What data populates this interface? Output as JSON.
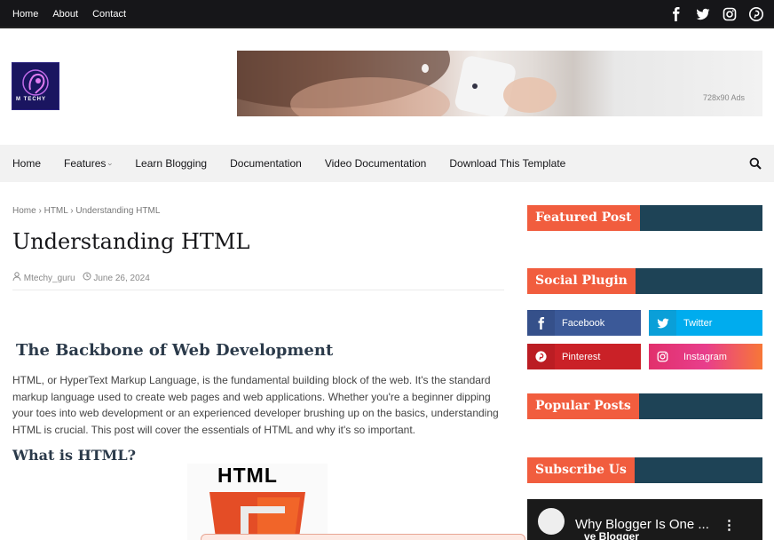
{
  "top_nav": {
    "links": [
      "Home",
      "About",
      "Contact"
    ]
  },
  "top_social": {
    "icons": [
      "facebook-icon",
      "twitter-icon",
      "instagram-icon",
      "pinterest-icon"
    ]
  },
  "header": {
    "logo_text": "M TECHY",
    "ad_label": "728x90 Ads"
  },
  "main_nav": {
    "items": [
      "Home",
      "Features",
      "Learn Blogging",
      "Documentation",
      "Video Documentation",
      "Download This Template"
    ],
    "features_caret": "›"
  },
  "post": {
    "breadcrumb": [
      "Home",
      "HTML",
      "Understanding HTML"
    ],
    "breadcrumb_sep": "›",
    "title": "Understanding HTML",
    "author": "Mtechy_guru",
    "date": "June 26, 2024",
    "h2": "The Backbone of Web Development",
    "paragraph": "HTML, or HyperText Markup Language, is the fundamental building block of the web. It's the standard markup language used to create web pages and web applications. Whether you're a beginner dipping your toes into web development or an experienced developer brushing up on the basics, understanding HTML is crucial. This post will cover the essentials of HTML and why it's so important.",
    "h3": "What is HTML?",
    "image_text": "HTML"
  },
  "sidebar": {
    "featured_post": "Featured Post",
    "social_plugin": "Social Plugin",
    "social_buttons": [
      {
        "label": "Facebook",
        "glyph": "f",
        "color": "#3b5998"
      },
      {
        "label": "Twitter",
        "glyph": "t",
        "color": "#00acee"
      },
      {
        "label": "Pinterest",
        "glyph": "p",
        "color": "#ca2127"
      },
      {
        "label": "Instagram",
        "glyph": "i",
        "color": "#dd2a7b"
      }
    ],
    "popular_posts": "Popular Posts",
    "subscribe_us": "Subscribe Us",
    "video": {
      "title": "Why Blogger Is One ...",
      "subtitle": "ve Blogger"
    }
  },
  "colors": {
    "accent": "#f15d3e",
    "widget_bar": "#1e4356",
    "topbar": "#161619"
  }
}
